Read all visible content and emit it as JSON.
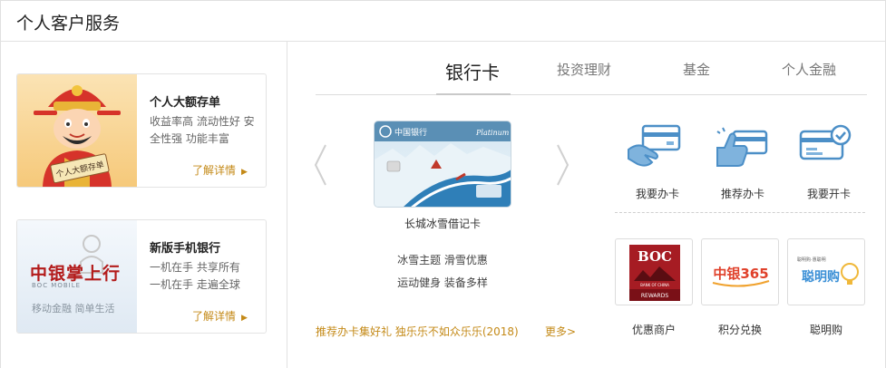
{
  "header": {
    "title": "个人客户服务"
  },
  "left_cards": [
    {
      "title": "个人大额存单",
      "desc": "收益率高 流动性好 安全性强 功能丰富",
      "more": "了解详情",
      "image_sign": "个人大额存单"
    },
    {
      "title": "新版手机银行",
      "desc_lines": [
        "一机在手 共享所有",
        "一机在手 走遍全球"
      ],
      "more": "了解详情",
      "image_logo": "中银掌上行",
      "image_sub": "BOC MOBILE",
      "image_slogan": "移动金融 简单生活"
    }
  ],
  "tabs": [
    {
      "label": "银行卡",
      "active": true
    },
    {
      "label": "投资理财",
      "active": false
    },
    {
      "label": "基金",
      "active": false
    },
    {
      "label": "个人金融",
      "active": false
    }
  ],
  "carousel": {
    "card_name": "长城冰雪借记卡",
    "card_brand": "中国银行",
    "card_tier": "Platinum",
    "lines": [
      "冰雪主题 滑雪优惠",
      "运动健身 装备多样"
    ],
    "promo_link": "推荐办卡集好礼 独乐乐不如众乐乐(2018)",
    "more_link": "更多>"
  },
  "services": [
    {
      "label": "我要办卡",
      "icon": "card-in-hand-icon"
    },
    {
      "label": "推荐办卡",
      "icon": "thumbs-up-card-icon"
    },
    {
      "label": "我要开卡",
      "icon": "card-activate-check-icon"
    }
  ],
  "partners": [
    {
      "label": "优惠商户",
      "logo_text": "BOC",
      "logo_sub": "REWARDS",
      "logo_fine": "BANK OF CHINA"
    },
    {
      "label": "积分兑换",
      "logo_text": "中银365"
    },
    {
      "label": "聪明购",
      "logo_text": "聪明购",
      "logo_fine": "聪明购·惠聪明"
    }
  ],
  "colors": {
    "accent_gold": "#c48a18",
    "icon_blue": "#4c8fc7",
    "boc_red": "#b31b1b"
  }
}
